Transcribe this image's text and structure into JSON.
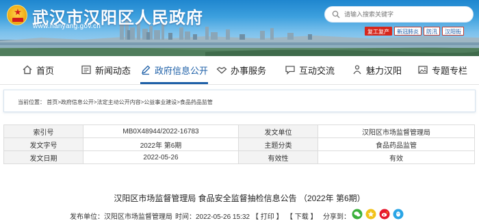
{
  "header": {
    "site_title": "武汉市汉阳区人民政府",
    "site_url": "www.hanyang.gov.cn",
    "search_placeholder": "请输入搜索关键字",
    "quick_links": [
      "复工复产",
      "新冠肺炎",
      "防汛",
      "汉阳街"
    ]
  },
  "nav": [
    {
      "label": "首页",
      "icon": "home-icon"
    },
    {
      "label": "新闻动态",
      "icon": "newspaper-icon"
    },
    {
      "label": "政府信息公开",
      "icon": "pen-icon"
    },
    {
      "label": "办事服务",
      "icon": "handshake-icon"
    },
    {
      "label": "互动交流",
      "icon": "chat-icon"
    },
    {
      "label": "魅力汉阳",
      "icon": "person-icon"
    },
    {
      "label": "专题专栏",
      "icon": "image-icon"
    }
  ],
  "breadcrumb": {
    "prefix": "当前位置：",
    "items": [
      "首页",
      "政府信息公开",
      "法定主动公开内容",
      "公益事业建设",
      "食品药品监管"
    ],
    "separator": ">"
  },
  "meta": {
    "index_label": "索引号",
    "index_value": "MB0X48944/2022-16783",
    "issuer_label": "发文单位",
    "issuer_value": "汉阳区市场监督管理局",
    "doc_no_label": "发文字号",
    "doc_no_value": "2022年 第6期",
    "topic_label": "主题分类",
    "topic_value": "食品药品监管",
    "date_label": "发文日期",
    "date_value": "2022-05-26",
    "validity_label": "有效性",
    "validity_value": "有效"
  },
  "article": {
    "title": "汉阳区市场监督管理局 食品安全监督抽检信息公告 （2022年 第6期）",
    "source": "发布单位：汉阳区市场监督管理局",
    "time": "时间：2022-05-26 15:32",
    "print": "【 打印 】",
    "download": "【 下载 】",
    "share": "分享到："
  },
  "colors": {
    "accent": "#1d5fa7",
    "label_bg": "#f3f3f3",
    "quick_link_red": "#d6271d"
  }
}
